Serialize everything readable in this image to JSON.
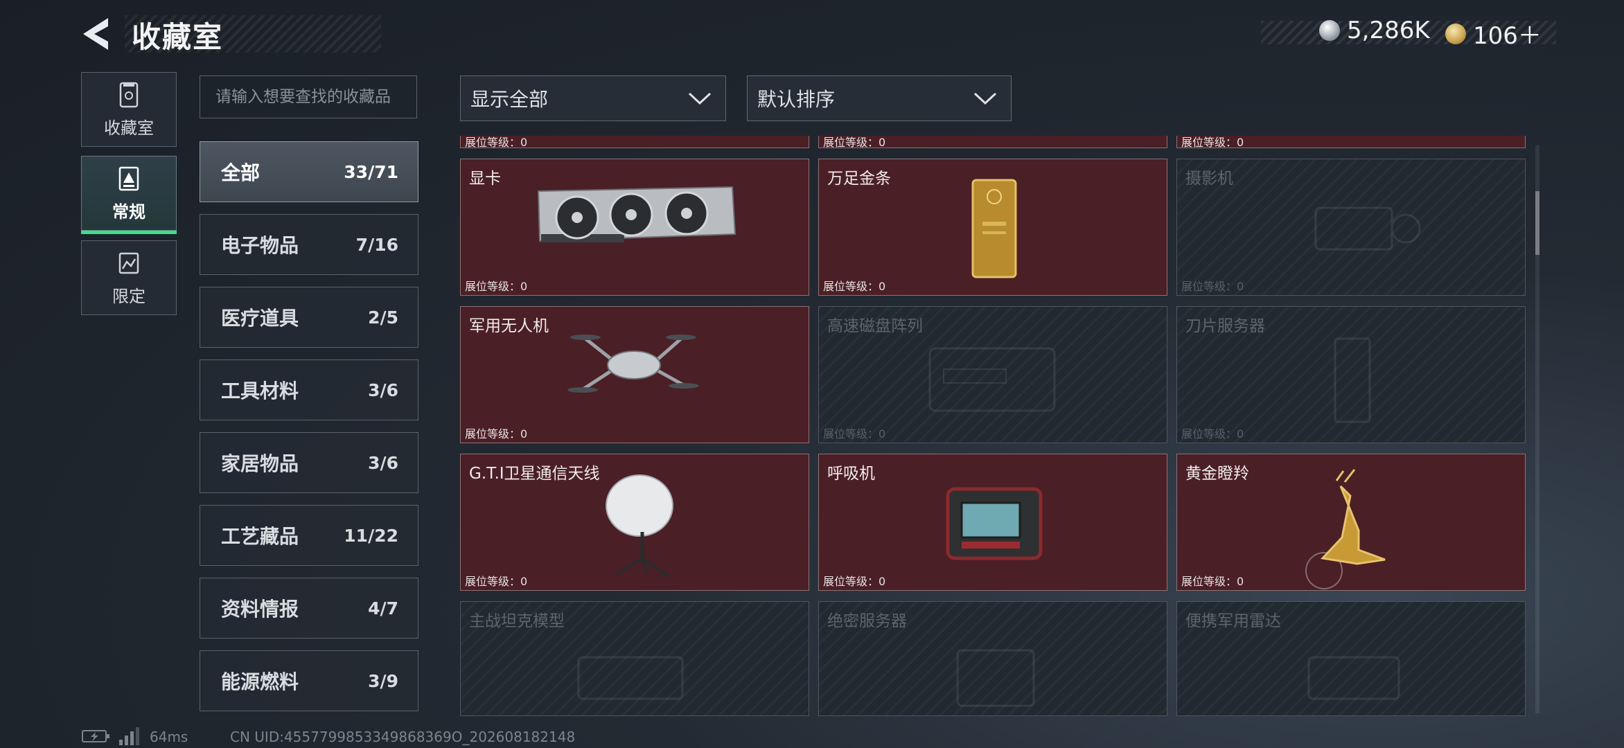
{
  "header": {
    "title": "收藏室"
  },
  "currency": [
    {
      "icon": "silver-coin-icon",
      "value": "5,286K"
    },
    {
      "icon": "gold-coin-icon",
      "value": "106＋"
    }
  ],
  "mode_tabs": [
    {
      "label": "收藏室",
      "icon": "collection-room-icon",
      "active": false
    },
    {
      "label": "常规",
      "icon": "regular-icon",
      "active": true
    },
    {
      "label": "限定",
      "icon": "limited-icon",
      "active": false
    }
  ],
  "search": {
    "placeholder": "请输入想要查找的收藏品"
  },
  "filters": {
    "display": "显示全部",
    "sort": "默认排序"
  },
  "categories": [
    {
      "name": "全部",
      "count": "33/71",
      "active": true
    },
    {
      "name": "电子物品",
      "count": "7/16"
    },
    {
      "name": "医疗道具",
      "count": "2/5"
    },
    {
      "name": "工具材料",
      "count": "3/6"
    },
    {
      "name": "家居物品",
      "count": "3/6"
    },
    {
      "name": "工艺藏品",
      "count": "11/22"
    },
    {
      "name": "资料情报",
      "count": "4/7"
    },
    {
      "name": "能源燃料",
      "count": "3/9"
    }
  ],
  "level_label": "展位等级：",
  "partial_row": [
    {
      "level": "0"
    },
    {
      "level": "0"
    },
    {
      "level": "0"
    }
  ],
  "items": [
    {
      "name": "显卡",
      "level": "0",
      "owned": true,
      "icon": "graphics-card-icon"
    },
    {
      "name": "万足金条",
      "level": "0",
      "owned": true,
      "icon": "gold-bar-icon"
    },
    {
      "name": "摄影机",
      "level": "0",
      "owned": false,
      "icon": "camera-icon"
    },
    {
      "name": "军用无人机",
      "level": "0",
      "owned": true,
      "icon": "drone-icon"
    },
    {
      "name": "高速磁盘阵列",
      "level": "0",
      "owned": false,
      "icon": "disk-array-icon"
    },
    {
      "name": "刀片服务器",
      "level": "0",
      "owned": false,
      "icon": "blade-server-icon"
    },
    {
      "name": "G.T.I卫星通信天线",
      "level": "0",
      "owned": true,
      "icon": "satellite-antenna-icon"
    },
    {
      "name": "呼吸机",
      "level": "0",
      "owned": true,
      "icon": "ventilator-icon"
    },
    {
      "name": "黄金瞪羚",
      "level": "0",
      "owned": true,
      "icon": "golden-gazelle-icon"
    },
    {
      "name": "主战坦克模型",
      "owned": false,
      "icon": "tank-model-icon"
    },
    {
      "name": "绝密服务器",
      "owned": false,
      "icon": "secret-server-icon"
    },
    {
      "name": "便携军用雷达",
      "owned": false,
      "icon": "portable-radar-icon"
    }
  ],
  "footer": {
    "ping": "64ms",
    "uid": "CN UID:4557799853349868369O_202608182148"
  },
  "colors": {
    "owned_card": "#4a1f25",
    "locked_card": "#212931",
    "active_accent": "#3ee08a"
  }
}
